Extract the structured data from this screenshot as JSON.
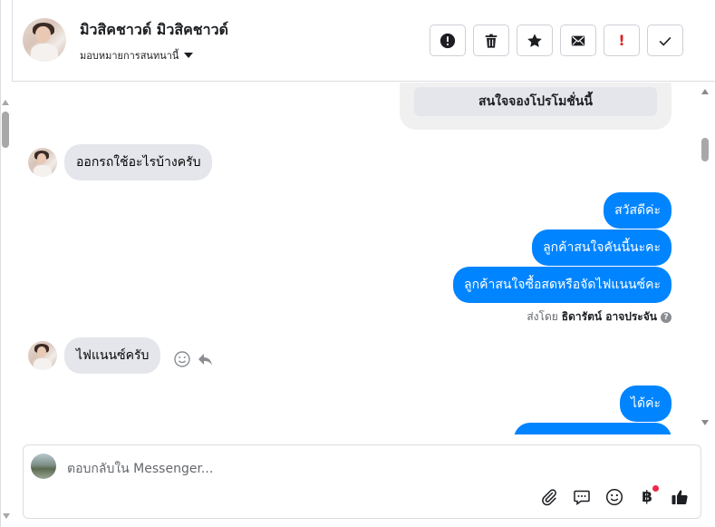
{
  "header": {
    "contact_name": "มิวสิคชาวด์ มิวสิคชาวด์",
    "assign_label": "มอบหมายการสนทนานี้",
    "actions": [
      {
        "name": "mark-spam-button",
        "icon": "exclamation-circle-icon"
      },
      {
        "name": "delete-button",
        "icon": "trash-icon"
      },
      {
        "name": "star-button",
        "icon": "star-icon"
      },
      {
        "name": "mark-unread-button",
        "icon": "envelope-icon"
      },
      {
        "name": "follow-up-button",
        "icon": "exclamation-icon",
        "label": "!"
      },
      {
        "name": "mark-done-button",
        "icon": "check-icon"
      }
    ]
  },
  "chat": {
    "card_button_label": "สนใจจองโปรโมชั่นนี้",
    "messages": [
      {
        "direction": "in",
        "text": "ออกรถใช้อะไรบ้างครับ"
      },
      {
        "direction": "out",
        "text": "สวัสดีค่ะ"
      },
      {
        "direction": "out",
        "text": "ลูกค้าสนใจคันนี้นะคะ"
      },
      {
        "direction": "out",
        "text": "ลูกค้าสนใจซื้อสดหรือจัดไฟแนนซ์คะ"
      },
      {
        "direction": "in",
        "text": "ไฟแนนซ์ครับ"
      },
      {
        "direction": "out",
        "text": "ได้ค่ะ"
      }
    ],
    "sent_by_prefix": "ส่งโดย",
    "sent_by_name": "ธิดารัตน์ อาจประจัน",
    "help_glyph": "?"
  },
  "composer": {
    "placeholder": "ตอบกลับใน Messenger...",
    "currency_symbol": "฿",
    "notification_color": "#f02849"
  },
  "colors": {
    "outgoing_bubble": "#0084ff",
    "incoming_bubble": "#e4e6eb"
  }
}
